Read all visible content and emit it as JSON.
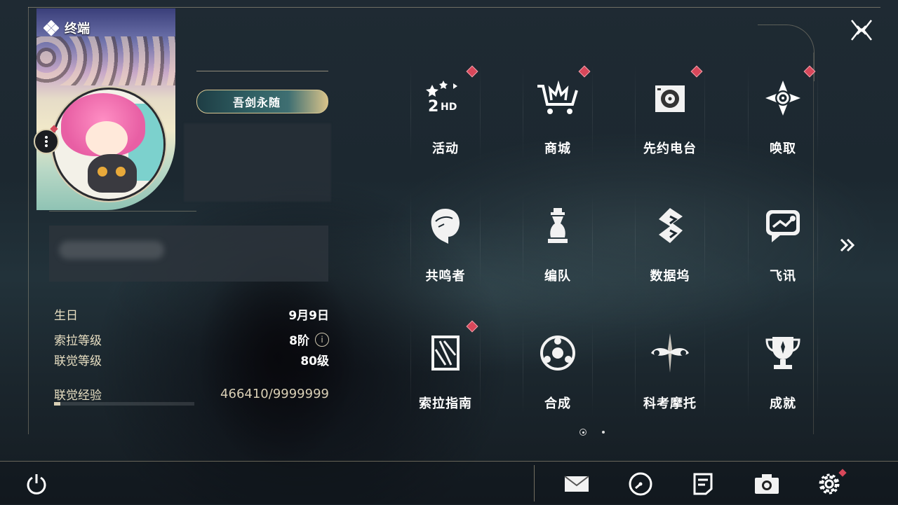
{
  "header": {
    "title": "终端"
  },
  "profile": {
    "name_plate": "吾剑永随",
    "stats": [
      {
        "label": "生日",
        "value": "9月9日"
      },
      {
        "label": "索拉等级",
        "value": "8阶",
        "info": "i"
      },
      {
        "label": "联觉等级",
        "value": "80级"
      }
    ],
    "exp": {
      "label": "联觉经验",
      "value": "466410/9999999",
      "progress": 0.047
    }
  },
  "menu": {
    "rows": [
      [
        {
          "label": "活动",
          "icon": "events-2hd-icon",
          "badge": true
        },
        {
          "label": "商城",
          "icon": "shop-cart-icon",
          "badge": true
        },
        {
          "label": "先约电台",
          "icon": "radio-icon",
          "badge": true
        },
        {
          "label": "唤取",
          "icon": "convene-icon",
          "badge": true
        }
      ],
      [
        {
          "label": "共鸣者",
          "icon": "resonator-icon",
          "badge": false
        },
        {
          "label": "编队",
          "icon": "team-chess-icon",
          "badge": false
        },
        {
          "label": "数据坞",
          "icon": "data-dock-icon",
          "badge": false
        },
        {
          "label": "飞讯",
          "icon": "message-icon",
          "badge": false
        }
      ],
      [
        {
          "label": "索拉指南",
          "icon": "guide-icon",
          "badge": true
        },
        {
          "label": "合成",
          "icon": "synthesis-icon",
          "badge": false
        },
        {
          "label": "科考摩托",
          "icon": "motorcycle-icon",
          "badge": false
        },
        {
          "label": "成就",
          "icon": "trophy-icon",
          "badge": false
        }
      ]
    ],
    "page": {
      "current": 1,
      "total": 2
    }
  },
  "bottom_bar": {
    "icons": [
      "power-icon",
      "mail-icon",
      "clock-icon",
      "notes-icon",
      "camera-icon",
      "settings-icon"
    ]
  },
  "colors": {
    "badge": "#d8475a",
    "gold_line": "#d2c3a0",
    "text": "#ffffff"
  }
}
